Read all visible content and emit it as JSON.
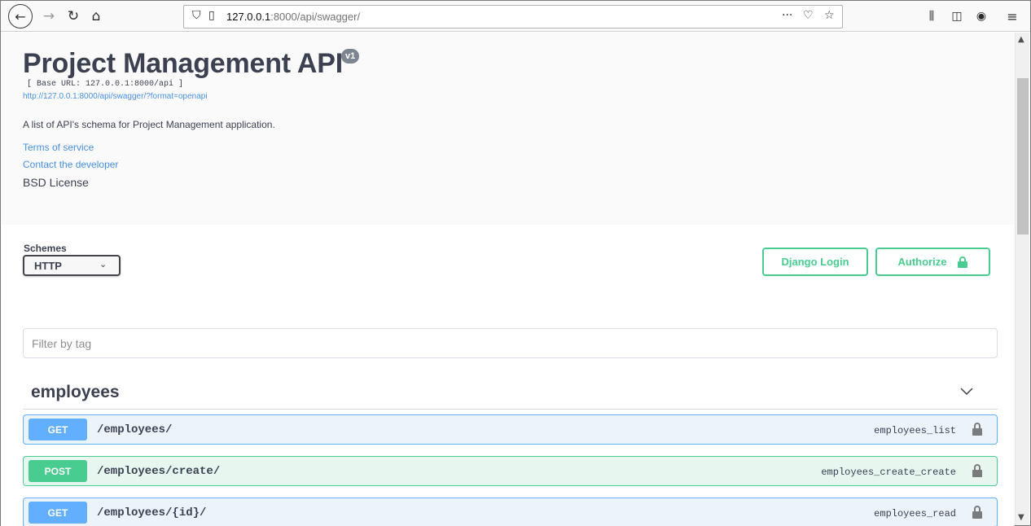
{
  "browser": {
    "url_host": "127.0.0.1",
    "url_rest": ":8000/api/swagger/",
    "icons": [
      "back-arrow-icon",
      "forward-arrow-icon",
      "reload-icon",
      "home-icon",
      "shield-icon",
      "page-icon",
      "more-icon",
      "pocket-icon",
      "star-icon",
      "library-icon",
      "sidebar-icon",
      "account-icon",
      "menu-icon"
    ]
  },
  "info": {
    "title": "Project Management API",
    "version": "v1",
    "base_url": "[ Base URL: 127.0.0.1:8000/api ]",
    "spec_link": "http://127.0.0.1:8000/api/swagger/?format=openapi",
    "description": "A list of API's schema for Project Management application.",
    "terms": "Terms of service",
    "contact": "Contact the developer",
    "license": "BSD License"
  },
  "schemes": {
    "label": "Schemes",
    "selected": "HTTP",
    "django_login": "Django Login",
    "authorize": "Authorize"
  },
  "filter": {
    "placeholder": "Filter by tag"
  },
  "tag": {
    "name": "employees",
    "operations": [
      {
        "method": "GET",
        "path": "/employees/",
        "operation_id": "employees_list"
      },
      {
        "method": "POST",
        "path": "/employees/create/",
        "operation_id": "employees_create_create"
      },
      {
        "method": "GET",
        "path": "/employees/{id}/",
        "operation_id": "employees_read"
      }
    ]
  },
  "colors": {
    "get": "#61affe",
    "post": "#49cc90",
    "link": "#4990e2",
    "text": "#3b4151"
  }
}
